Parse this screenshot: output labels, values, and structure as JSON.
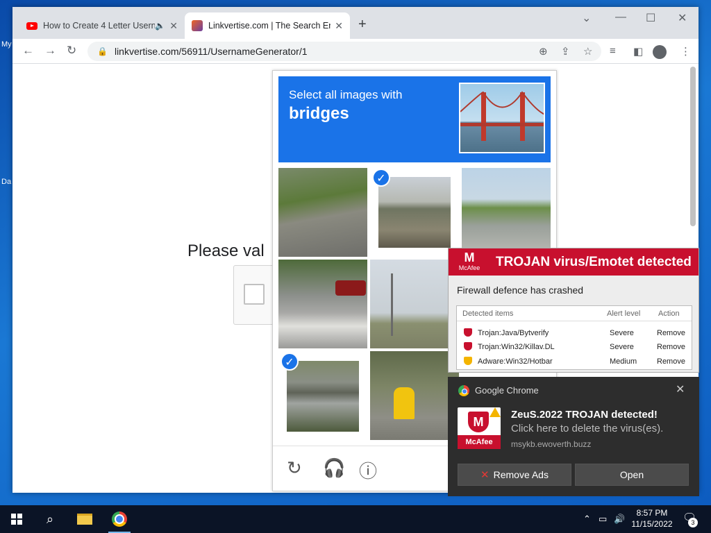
{
  "desktop": {
    "label1": "My",
    "label2": "Da"
  },
  "browser": {
    "tabs": [
      {
        "title": "How to Create 4 Letter Usern",
        "icon": "youtube-icon"
      },
      {
        "title": "Linkvertise.com | The Search Eng",
        "icon": "linkvertise-icon"
      }
    ],
    "url": "linkvertise.com/56911/UsernameGenerator/1"
  },
  "page": {
    "heading": "Please val"
  },
  "captcha": {
    "instruction": "Select all images with",
    "object": "bridges",
    "selected_tiles": [
      1,
      6
    ]
  },
  "mcafee_popup": {
    "brand": "McAfee",
    "title": "TROJAN virus/Emotet detected",
    "subtitle": "Firewall defence has crashed",
    "columns": [
      "Detected items",
      "Alert level",
      "Action"
    ],
    "rows": [
      {
        "item": "Trojan:Java/Bytverify",
        "level": "Severe",
        "action": "Remove",
        "color": "#c8102e"
      },
      {
        "item": "Trojan:Win32/Killav.DL",
        "level": "Severe",
        "action": "Remove",
        "color": "#c8102e"
      },
      {
        "item": "Adware:Win32/Hotbar",
        "level": "Medium",
        "action": "Remove",
        "color": "#f4b400"
      }
    ]
  },
  "notification": {
    "app": "Google Chrome",
    "logo_text": "McAfee",
    "title": "ZeuS.2022 TROJAN detected!",
    "message": "Click here to delete the virus(es).",
    "source": "msykb.ewoverth.buzz",
    "btn_remove": "Remove Ads",
    "btn_open": "Open"
  },
  "taskbar": {
    "time": "8:57 PM",
    "date": "11/15/2022",
    "notification_count": "3"
  }
}
